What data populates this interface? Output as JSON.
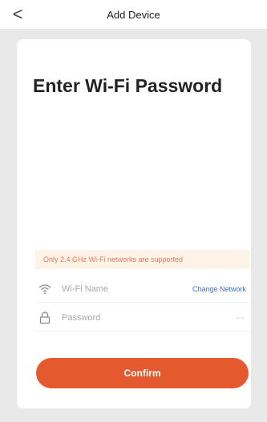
{
  "header": {
    "back_glyph": "<",
    "title": "Add Device"
  },
  "page": {
    "heading": "Enter Wi-Fi Password"
  },
  "notice": {
    "text": "Only 2.4 GHz Wi-Fi networks are supported"
  },
  "wifi": {
    "placeholder": "Wi-Fi Name",
    "change_label": "Change Network",
    "icon": "wifi-icon"
  },
  "password": {
    "placeholder": "Password",
    "toggle_glyph": "~~",
    "icon": "lock-icon"
  },
  "actions": {
    "confirm_label": "Confirm"
  },
  "colors": {
    "accent": "#e4592e",
    "notice_bg": "#fdf3e7",
    "notice_text": "#e6795a",
    "link": "#3a6fcf"
  }
}
